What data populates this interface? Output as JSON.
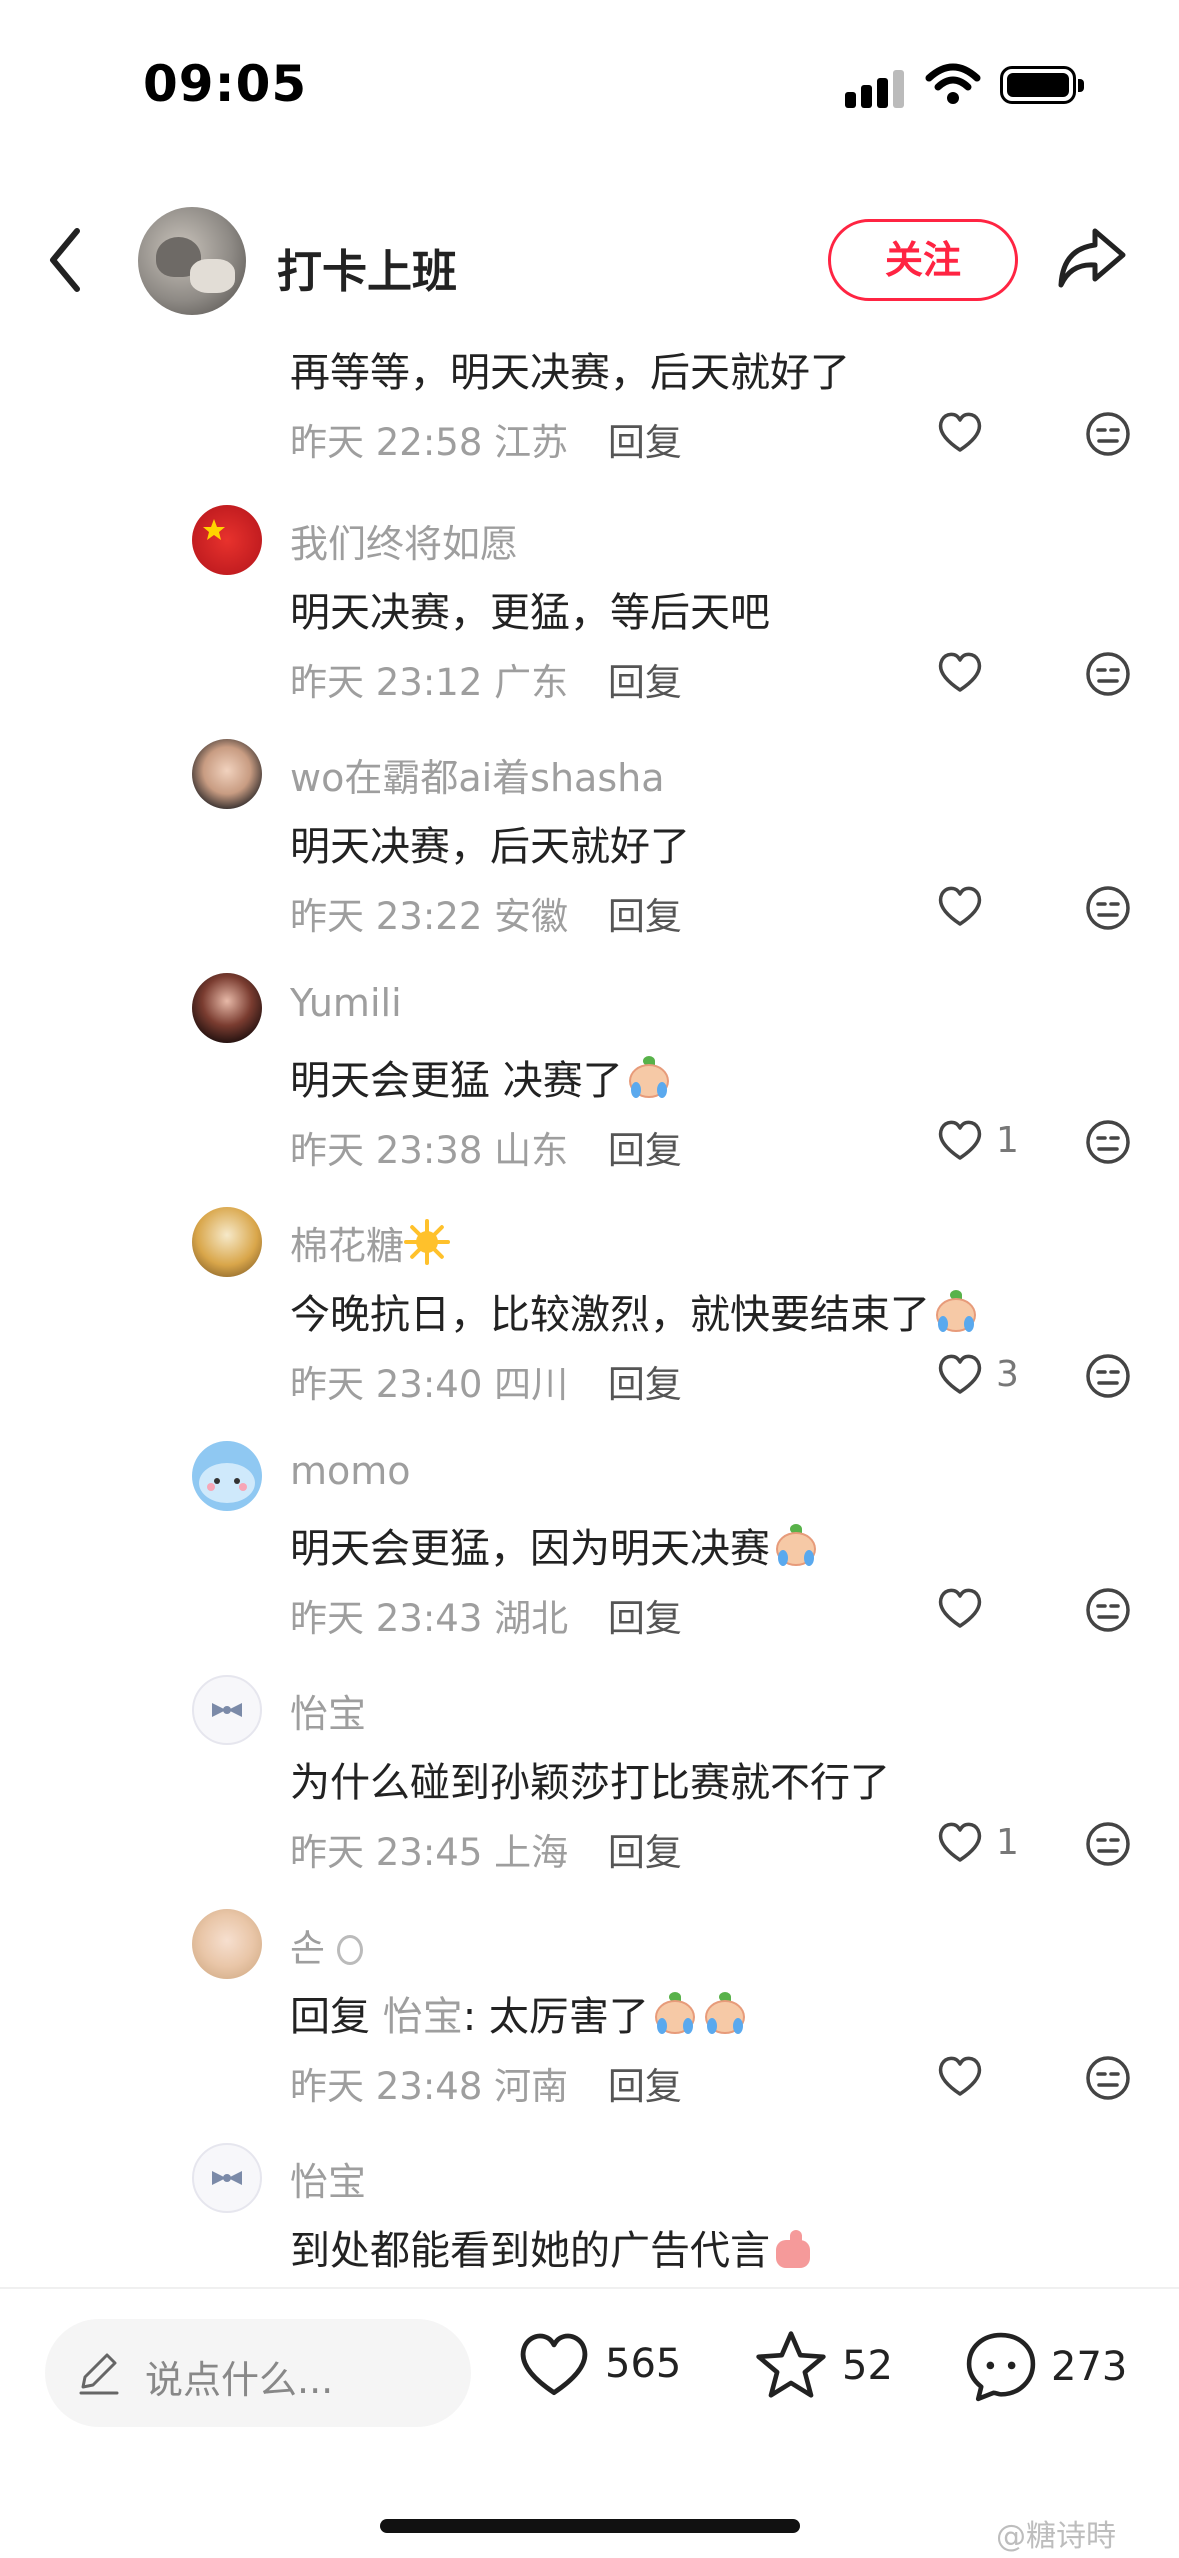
{
  "status": {
    "time": "09:05"
  },
  "header": {
    "title": "打卡上班",
    "follow_label": "关注"
  },
  "comments": [
    {
      "text": "再等等，明天决赛，后天就好了",
      "time": "昨天 22:58",
      "region": "江苏",
      "reply_label": "回复",
      "likes": ""
    },
    {
      "user": "我们终将如愿",
      "text": "明天决赛，更猛，等后天吧",
      "time": "昨天 23:12",
      "region": "广东",
      "reply_label": "回复",
      "likes": ""
    },
    {
      "user": "wo在霸都ai着shasha",
      "text": "明天决赛，后天就好了",
      "time": "昨天 23:22",
      "region": "安徽",
      "reply_label": "回复",
      "likes": ""
    },
    {
      "user": "Yumili",
      "text": "明天会更猛  决赛了",
      "time": "昨天 23:38",
      "region": "山东",
      "reply_label": "回复",
      "likes": "1"
    },
    {
      "user": "棉花糖",
      "text": "今晚抗日，比较激烈，就快要结束了",
      "time": "昨天 23:40",
      "region": "四川",
      "reply_label": "回复",
      "likes": "3"
    },
    {
      "user": "momo",
      "text": "明天会更猛，因为明天决赛",
      "time": "昨天 23:43",
      "region": "湖北",
      "reply_label": "回复",
      "likes": ""
    },
    {
      "user": "怡宝",
      "text": "为什么碰到孙颖莎打比赛就不行了",
      "time": "昨天 23:45",
      "region": "上海",
      "reply_label": "回复",
      "likes": "1"
    },
    {
      "user": "손",
      "reply_prefix": "回复",
      "reply_to": "怡宝",
      "text": ": 太厉害了",
      "time": "昨天 23:48",
      "region": "河南",
      "reply_label": "回复",
      "likes": ""
    },
    {
      "user": "怡宝",
      "text": "到处都能看到她的广告代言"
    }
  ],
  "bottom": {
    "input_placeholder": "说点什么...",
    "likes": "565",
    "collects": "52",
    "comments": "273",
    "watermark": "@糖诗時"
  },
  "colors": {
    "accent": "#ff2442",
    "secondary_text": "#9e9e9e"
  },
  "icons": [
    "back-icon",
    "share-icon",
    "heart-icon",
    "dislike-icon",
    "star-icon",
    "comment-icon",
    "pen-icon"
  ]
}
